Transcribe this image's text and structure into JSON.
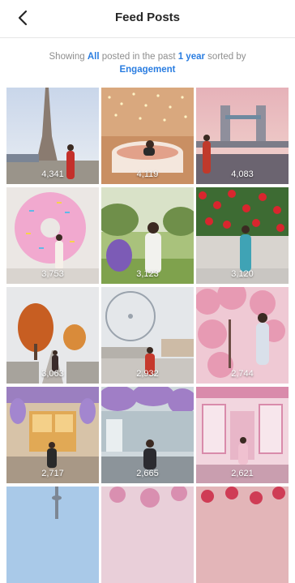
{
  "header": {
    "back_icon": "chevron-left-icon",
    "title": "Feed Posts"
  },
  "filter": {
    "prefix": "Showing ",
    "scope": "All",
    "middle": " posted in the past ",
    "period": "1 year",
    "suffix": " sorted by ",
    "sort": "Engagement",
    "link_color": "#2a7de1"
  },
  "posts": [
    {
      "engagement": "4,341"
    },
    {
      "engagement": "4,119"
    },
    {
      "engagement": "4,083"
    },
    {
      "engagement": "3,753"
    },
    {
      "engagement": "3,123"
    },
    {
      "engagement": "3,120"
    },
    {
      "engagement": "3,063"
    },
    {
      "engagement": "2,932"
    },
    {
      "engagement": "2,744"
    },
    {
      "engagement": "2,717"
    },
    {
      "engagement": "2,665"
    },
    {
      "engagement": "2,621"
    },
    {
      "engagement": ""
    },
    {
      "engagement": ""
    },
    {
      "engagement": ""
    }
  ]
}
